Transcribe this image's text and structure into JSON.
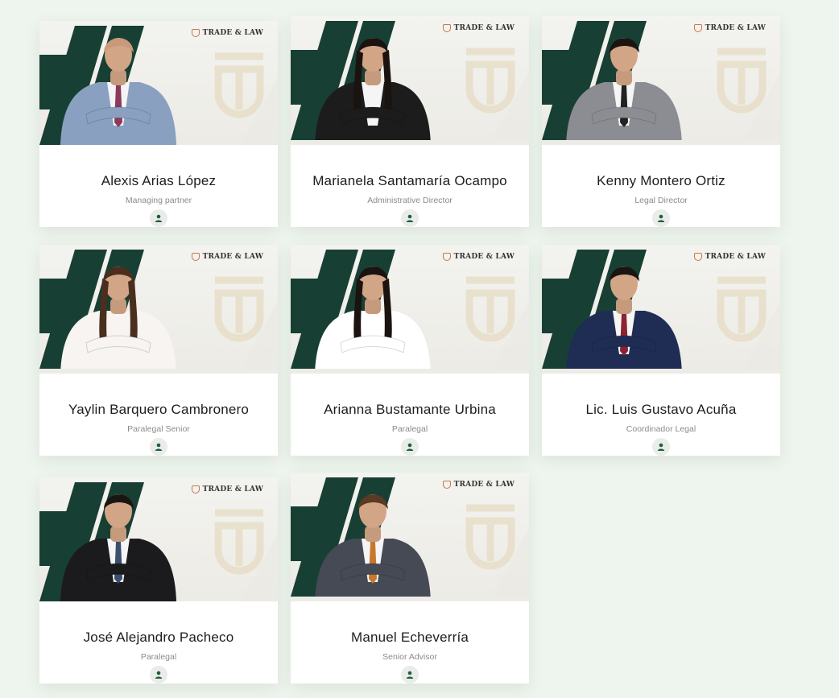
{
  "brand": {
    "name": "TRADE & LAW",
    "accent": "#183f33"
  },
  "team": [
    {
      "name": "Alexis Arias López",
      "role": "Managing partner",
      "suit": "#8aa0c0",
      "shirt": "#f4f4f4",
      "tie": "#8b3a5c",
      "hair": "bald"
    },
    {
      "name": "Marianela Santamaría Ocampo",
      "role": "Administrative Director",
      "suit": "#1c1c1c",
      "shirt": "#f5f5f5",
      "tie": "",
      "hair": "long-dark"
    },
    {
      "name": "Kenny Montero Ortiz",
      "role": "Legal Director",
      "suit": "#8b8d92",
      "shirt": "#f5f5f5",
      "tie": "#222222",
      "hair": "short-dark"
    },
    {
      "name": "Yaylin Barquero Cambronero",
      "role": "Paralegal Senior",
      "suit": "#f7f4f1",
      "shirt": "#f7f4f1",
      "tie": "",
      "hair": "long-brown"
    },
    {
      "name": "Arianna Bustamante Urbina",
      "role": "Paralegal",
      "suit": "#ffffff",
      "shirt": "#ffffff",
      "tie": "",
      "hair": "long-dark"
    },
    {
      "name": "Lic. Luis Gustavo Acuña",
      "role": "Coordinador Legal",
      "suit": "#1f2d55",
      "shirt": "#f5f5f5",
      "tie": "#8b2332",
      "hair": "short-dark"
    },
    {
      "name": "José Alejandro Pacheco",
      "role": "Paralegal",
      "suit": "#1b1b1e",
      "shirt": "#f5f5f5",
      "tie": "#3c4e6e",
      "hair": "short-dark"
    },
    {
      "name": "Manuel Echeverría",
      "role": "Senior Advisor",
      "suit": "#454a55",
      "shirt": "#f5f5f5",
      "tie": "#c7782d",
      "hair": "short-brown"
    }
  ]
}
